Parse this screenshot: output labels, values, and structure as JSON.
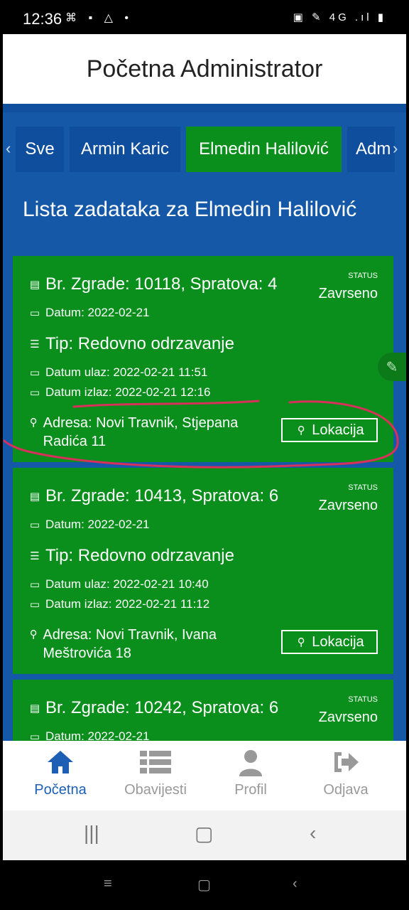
{
  "status_bar": {
    "time": "12:36",
    "left_icons": "⌘ ▪ △ •",
    "right_icons": "▣ ✎ 4G .ıl ▮"
  },
  "header": {
    "title": "Početna Administrator"
  },
  "tabs": [
    {
      "label": "Sve",
      "active": false
    },
    {
      "label": "Armin Karic",
      "active": false
    },
    {
      "label": "Elmedin Halilović",
      "active": true
    },
    {
      "label": "Adm",
      "active": false
    }
  ],
  "list_title": "Lista zadataka za Elmedin Halilović",
  "cards": [
    {
      "building": "Br. Zgrade: 10118, Spratova: 4",
      "status_label": "STATUS",
      "status": "Zavrseno",
      "datum": "Datum: 2022-02-21",
      "tip": "Tip: Redovno odrzavanje",
      "ulaz": "Datum ulaz: 2022-02-21 11:51",
      "izlaz": "Datum izlaz: 2022-02-21 12:16",
      "adresa": "Adresa: Novi Travnik, Stjepana Radića 11",
      "lokacija": "Lokacija"
    },
    {
      "building": "Br. Zgrade: 10413, Spratova: 6",
      "status_label": "STATUS",
      "status": "Zavrseno",
      "datum": "Datum: 2022-02-21",
      "tip": "Tip: Redovno odrzavanje",
      "ulaz": "Datum ulaz: 2022-02-21 10:40",
      "izlaz": "Datum izlaz: 2022-02-21 11:12",
      "adresa": "Adresa: Novi Travnik, Ivana Meštrovića 18",
      "lokacija": "Lokacija"
    },
    {
      "building": "Br. Zgrade: 10242, Spratova: 6",
      "status_label": "STATUS",
      "status": "Zavrseno",
      "datum": "Datum: 2022-02-21"
    }
  ],
  "bottom_nav": [
    {
      "label": "Početna",
      "icon": "home-icon",
      "active": true
    },
    {
      "label": "Obavijesti",
      "icon": "list-icon",
      "active": false
    },
    {
      "label": "Profil",
      "icon": "user-icon",
      "active": false
    },
    {
      "label": "Odjava",
      "icon": "logout-icon",
      "active": false
    }
  ],
  "colors": {
    "primary_blue": "#1658a8",
    "card_green": "#0a8f1c",
    "annotation_red": "#d8305a",
    "nav_active": "#1c5fb5"
  }
}
